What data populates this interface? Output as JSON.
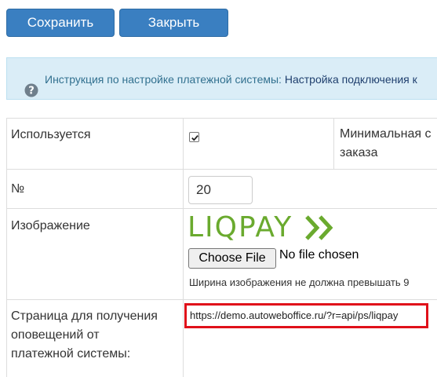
{
  "toolbar": {
    "save_label": "Сохранить",
    "close_label": "Закрыть"
  },
  "info": {
    "text": "Инструкция по настройке платежной системы: ",
    "link": "Настройка подключения к"
  },
  "rows": {
    "used": {
      "label": "Используется",
      "checked": true,
      "right_title_line1": "Минимальная с",
      "right_title_line2": "заказа"
    },
    "number": {
      "label": "№",
      "value": "20"
    },
    "image": {
      "label": "Изображение",
      "logo_text": "LIQPAY",
      "choose_file_label": "Choose File",
      "no_file_text": "No file chosen",
      "hint": "Ширина изображения не должна превышать 9"
    },
    "notify": {
      "label_line1": "Страница для получения",
      "label_line2": "оповещений от",
      "label_line3": "платежной системы:",
      "url": "https://demo.autoweboffice.ru/?r=api/ps/liqpay"
    }
  },
  "colors": {
    "button": "#3a7fc1",
    "info_bg": "#daedf7",
    "logo_green": "#6aaa2e",
    "highlight_border": "#e0101a"
  }
}
